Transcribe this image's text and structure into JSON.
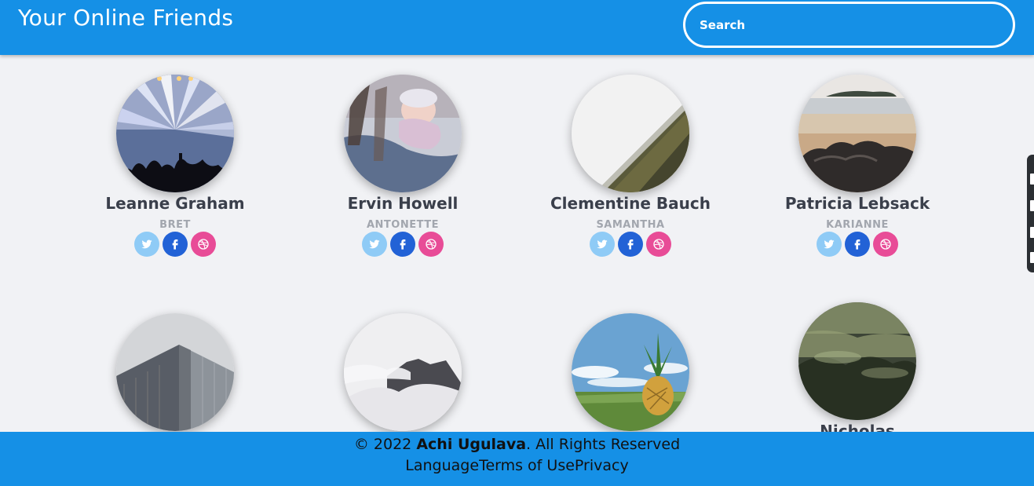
{
  "header": {
    "title": "Your Online Friends"
  },
  "search": {
    "placeholder": "Search"
  },
  "friends": [
    {
      "name": "Leanne Graham",
      "username": "BRET",
      "image": "concert-lights"
    },
    {
      "name": "Ervin Howell",
      "username": "ANTONETTE",
      "image": "baby-sleeping"
    },
    {
      "name": "Clementine Bauch",
      "username": "SAMANTHA",
      "image": "misty-forest-slope"
    },
    {
      "name": "Patricia Lebsack",
      "username": "KARIANNE",
      "image": "beach-rocks"
    },
    {
      "name": "",
      "username": "",
      "image": "skyscraper"
    },
    {
      "name": "",
      "username": "",
      "image": "cloudy-mountain"
    },
    {
      "name": "",
      "username": "",
      "image": "pineapple-field"
    },
    {
      "name": "Nicholas",
      "username": "",
      "image": "foggy-forest"
    }
  ],
  "socials": [
    "twitter-icon",
    "facebook-icon",
    "dribbble-icon"
  ],
  "footer": {
    "copyright_prefix": "© 2022",
    "author": "Achi Ugulava",
    "copyright_suffix": ". All Rights Reserved",
    "links": [
      "Language",
      "Terms of Use",
      "Privacy"
    ]
  },
  "colors": {
    "brand_blue": "#1590e6",
    "background": "#f1f2f5",
    "twitter": "#8fcbf6",
    "facebook": "#2262d6",
    "dribbble": "#e84c97"
  }
}
